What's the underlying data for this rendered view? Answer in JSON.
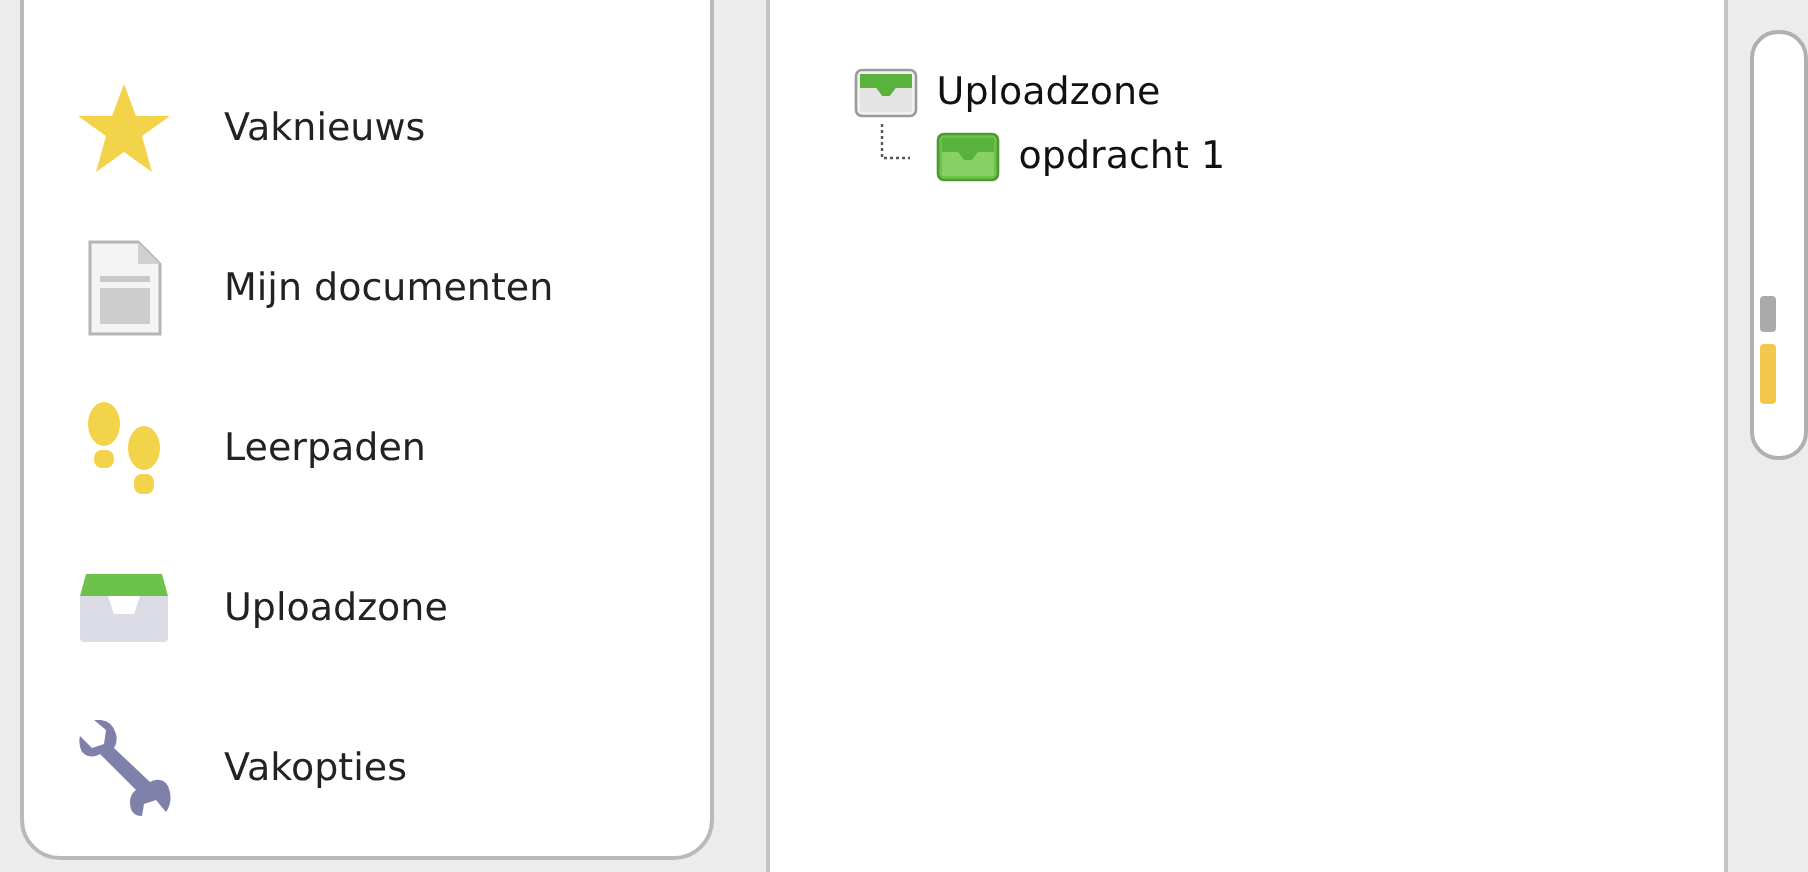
{
  "sidebar": {
    "items": [
      {
        "kind": "star",
        "label": "Vaknieuws"
      },
      {
        "kind": "document",
        "label": "Mijn documenten"
      },
      {
        "kind": "footprints",
        "label": "Leerpaden"
      },
      {
        "kind": "inbox",
        "label": "Uploadzone"
      },
      {
        "kind": "wrench",
        "label": "Vakopties"
      }
    ]
  },
  "tree": {
    "label": "Uploadzone",
    "children": [
      {
        "label": "opdracht 1"
      }
    ]
  }
}
